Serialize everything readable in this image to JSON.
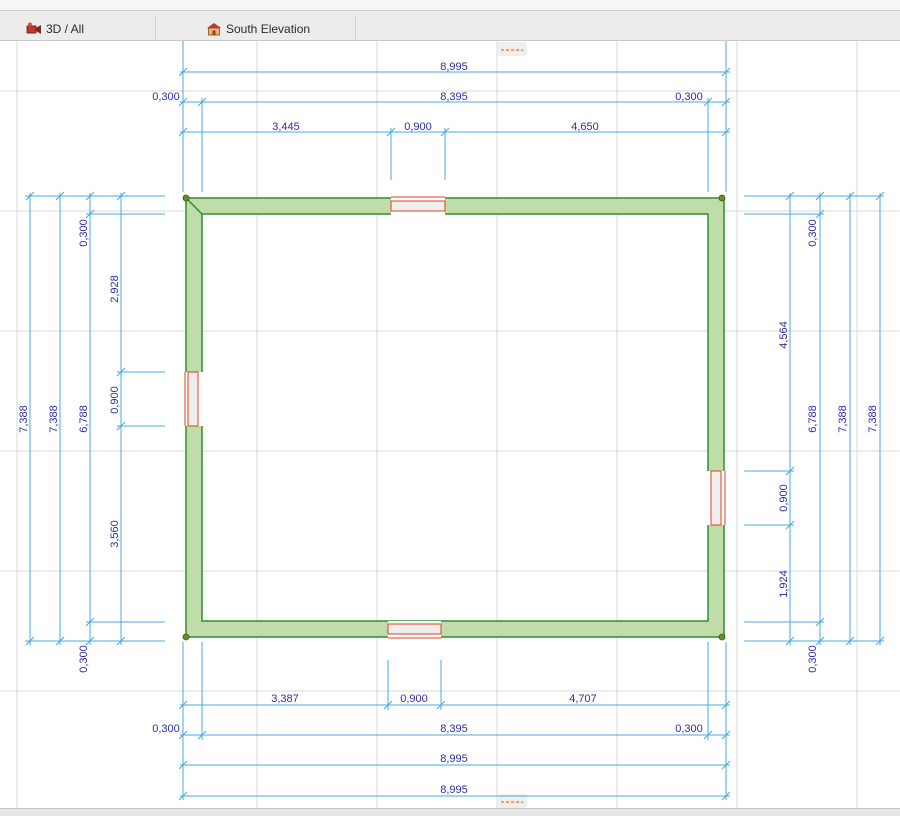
{
  "tabs": [
    {
      "label": "3D / All",
      "icon": "camera-icon"
    },
    {
      "label": "South Elevation",
      "icon": "house-icon"
    }
  ],
  "colors": {
    "wall_fill": "#bfdcaa",
    "wall_stroke": "#2f8f2f",
    "dimension_line": "#4aa8e0",
    "dimension_text": "#2e2ea8",
    "opening": "#e0421a",
    "grid": "#d9d9d9"
  },
  "dimensions": {
    "top_overall": "8,995",
    "top_side_left": "0,300",
    "top_inner": "8,395",
    "top_side_right": "0,300",
    "top_seg1": "3,445",
    "top_seg2": "0,900",
    "top_seg3": "4,650",
    "bottom_seg1": "3,387",
    "bottom_seg2": "0,900",
    "bottom_seg3": "4,707",
    "bottom_side_left": "0,300",
    "bottom_inner": "8,395",
    "bottom_side_right": "0,300",
    "bottom_overall1": "8,995",
    "bottom_overall2": "8,995",
    "left_overall1": "7,388",
    "left_overall2": "7,388",
    "left_inner": "6,788",
    "left_top": "0,300",
    "left_bottom": "0,300",
    "left_seg1": "2,928",
    "left_seg2": "0,900",
    "left_seg3": "3,560",
    "right_top": "0,300",
    "right_seg1": "4,564",
    "right_inner": "6,788",
    "right_overall1": "7,388",
    "right_overall2": "7,388",
    "right_seg2": "0,900",
    "right_seg3": "1,924",
    "right_bottom": "0,300"
  }
}
